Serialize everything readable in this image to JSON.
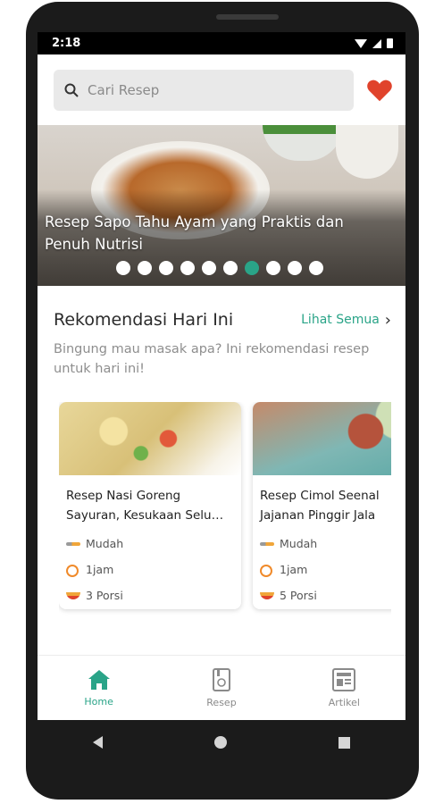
{
  "status": {
    "time": "2:18"
  },
  "search": {
    "placeholder": "Cari Resep"
  },
  "banner": {
    "title": "Resep Sapo Tahu Ayam yang Praktis dan Penuh Nutrisi",
    "dot_count": 10,
    "active_dot": 6
  },
  "recommendation": {
    "title": "Rekomendasi Hari Ini",
    "see_all": "Lihat Semua",
    "description": "Bingung mau masak apa? Ini rekomendasi resep untuk hari ini!"
  },
  "cards": [
    {
      "title_line1": "Resep Nasi Goreng",
      "title_line2": "Sayuran, Kesukaan Selu…",
      "difficulty": "Mudah",
      "time": "1jam",
      "portion": "3 Porsi"
    },
    {
      "title_line1": "Resep Cimol Seenal",
      "title_line2": "Jajanan Pinggir Jala",
      "difficulty": "Mudah",
      "time": "1jam",
      "portion": "5 Porsi"
    }
  ],
  "bottom_nav": [
    {
      "label": "Home",
      "icon": "home-icon",
      "active": true
    },
    {
      "label": "Resep",
      "icon": "recipe-book-icon",
      "active": false
    },
    {
      "label": "Artikel",
      "icon": "article-icon",
      "active": false
    }
  ],
  "colors": {
    "accent": "#2aa488",
    "heart": "#e0432c"
  }
}
